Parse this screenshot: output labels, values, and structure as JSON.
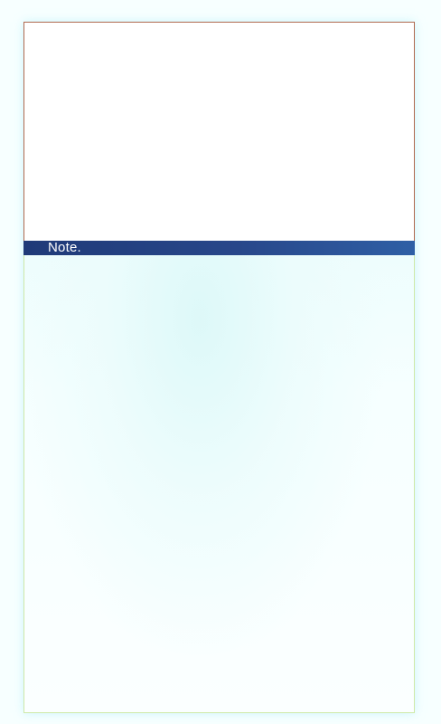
{
  "note": {
    "header_label": "Note.",
    "body_text": ""
  }
}
